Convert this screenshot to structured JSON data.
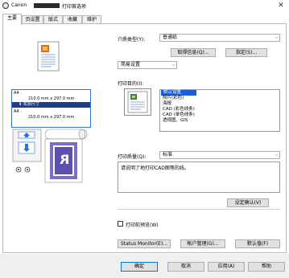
{
  "window": {
    "app": "Canon",
    "title": "打印首选项",
    "close_glyph": "✕"
  },
  "tabs": [
    {
      "label": "主要"
    },
    {
      "label": "页设置"
    },
    {
      "label": "版式"
    },
    {
      "label": "收藏"
    },
    {
      "label": "维护"
    }
  ],
  "preview": {
    "paper1_label": "A4 :",
    "paper1_size": "210.0 mm x 297.0 mm",
    "scale_label": "实际尺寸",
    "paper2_label": "A4 :",
    "paper2_size": "210.0 mm x 297.0 mm",
    "image_letter": "R"
  },
  "main": {
    "media_type_label": "介质类型(Y):",
    "media_type_value": "普通纸",
    "get_info_button": "取得信息(Q)...",
    "specify_button": "指定(S)...",
    "settings_mode_value": "简易设置",
    "print_target_label": "打印目的(I):",
    "print_targets": [
      "默认设置",
      "照片(彩色)",
      "海报",
      "CAD (彩色线条)",
      "CAD (单色线条)",
      "透视图、GIS"
    ],
    "selected_target_index": 0,
    "quality_label": "打印质量(Q):",
    "quality_value": "标准",
    "description": "请说明了地打印CAD图等的线。",
    "confirm_settings_button": "设定确认(V)",
    "preview_checkbox_label": "打印前预览(W)",
    "preview_checked": false,
    "status_monitor_button": "Status Monitor(E)...",
    "account_management_button": "帐户管理(G)...",
    "defaults_button": "默认值(F)"
  },
  "footer": {
    "ok_button": "确定",
    "cancel_button": "取消",
    "apply_button": "应用(A)",
    "help_button": "帮助"
  },
  "colors": {
    "selection": "#1a5fd6",
    "preview_navy": "#1a3d8f",
    "preview_purple": "#7a6fc4",
    "arrow_blue": "#2f6fd6"
  }
}
